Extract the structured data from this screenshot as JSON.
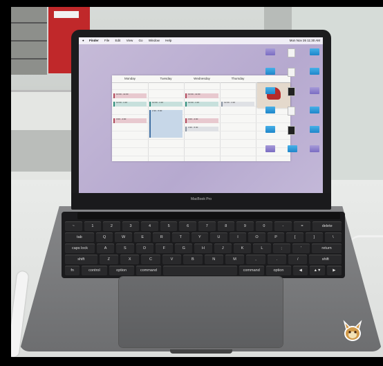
{
  "photo": {
    "laptop_brand_text": "MacBook Pro",
    "background_colors": {
      "wall": "#d7dbd8",
      "desk": "#e6e8e6",
      "laptop": "#7b7c7e",
      "wallpaper": "#bdb0d4"
    }
  },
  "screen": {
    "menu": {
      "app": "Finder",
      "items": [
        "File",
        "Edit",
        "View",
        "Go",
        "Window",
        "Help"
      ]
    },
    "status_text": "Mon Nov 26 11:30 AM",
    "calendar": {
      "days": [
        "Monday",
        "Tuesday",
        "Wednesday",
        "Thursday"
      ],
      "events": [
        {
          "day": 0,
          "slot": 1,
          "color": "pink",
          "text": "10:00 - 11:00"
        },
        {
          "day": 0,
          "slot": 2,
          "color": "teal",
          "text": "12:00 - 1:20"
        },
        {
          "day": 0,
          "slot": 4,
          "color": "pink",
          "text": "3:00 - 4:00"
        },
        {
          "day": 1,
          "slot": 2,
          "color": "teal",
          "text": "12:00 - 1:20"
        },
        {
          "day": 1,
          "slot": 3,
          "color": "blue",
          "text": "2:30 - 5:00"
        },
        {
          "day": 2,
          "slot": 1,
          "color": "pink",
          "text": "10:00 - 11:00"
        },
        {
          "day": 2,
          "slot": 2,
          "color": "teal",
          "text": "12:00 - 1:20"
        },
        {
          "day": 2,
          "slot": 4,
          "color": "pink",
          "text": "3:00 - 4:00"
        },
        {
          "day": 2,
          "slot": 5,
          "color": "gray",
          "text": "4:30 - 5:30"
        },
        {
          "day": 3,
          "slot": 2,
          "color": "gray",
          "text": "12:00 - 1:20"
        }
      ]
    },
    "desktop_icons": [
      {
        "kind": "folder-purple-icon"
      },
      {
        "kind": "doc-icon"
      },
      {
        "kind": "folder-icon"
      },
      {
        "kind": "folder-icon"
      },
      {
        "kind": "doc-icon"
      },
      {
        "kind": "folder-icon"
      },
      {
        "kind": "folder-icon"
      },
      {
        "kind": "dark-doc-icon"
      },
      {
        "kind": "folder-purple-icon"
      },
      {
        "kind": "folder-icon"
      },
      {
        "kind": "doc-icon"
      },
      {
        "kind": "folder-icon"
      },
      {
        "kind": "folder-icon"
      },
      {
        "kind": "dark-doc-icon"
      },
      {
        "kind": "folder-icon"
      },
      {
        "kind": "folder-purple-icon"
      },
      {
        "kind": "folder-icon"
      },
      {
        "kind": "folder-purple-icon"
      }
    ]
  },
  "keyboard": {
    "rows": [
      [
        "~",
        "1",
        "2",
        "3",
        "4",
        "5",
        "6",
        "7",
        "8",
        "9",
        "0",
        "-",
        "=",
        "delete"
      ],
      [
        "tab",
        "Q",
        "W",
        "E",
        "R",
        "T",
        "Y",
        "U",
        "I",
        "O",
        "P",
        "[",
        "]",
        "\\"
      ],
      [
        "caps lock",
        "A",
        "S",
        "D",
        "F",
        "G",
        "H",
        "J",
        "K",
        "L",
        ";",
        "'",
        "return"
      ],
      [
        "shift",
        "Z",
        "X",
        "C",
        "V",
        "B",
        "N",
        "M",
        ",",
        ".",
        "/",
        "shift"
      ],
      [
        "fn",
        "control",
        "option",
        "command",
        "",
        "command",
        "option",
        "◀",
        "▲▼",
        "▶"
      ]
    ]
  }
}
